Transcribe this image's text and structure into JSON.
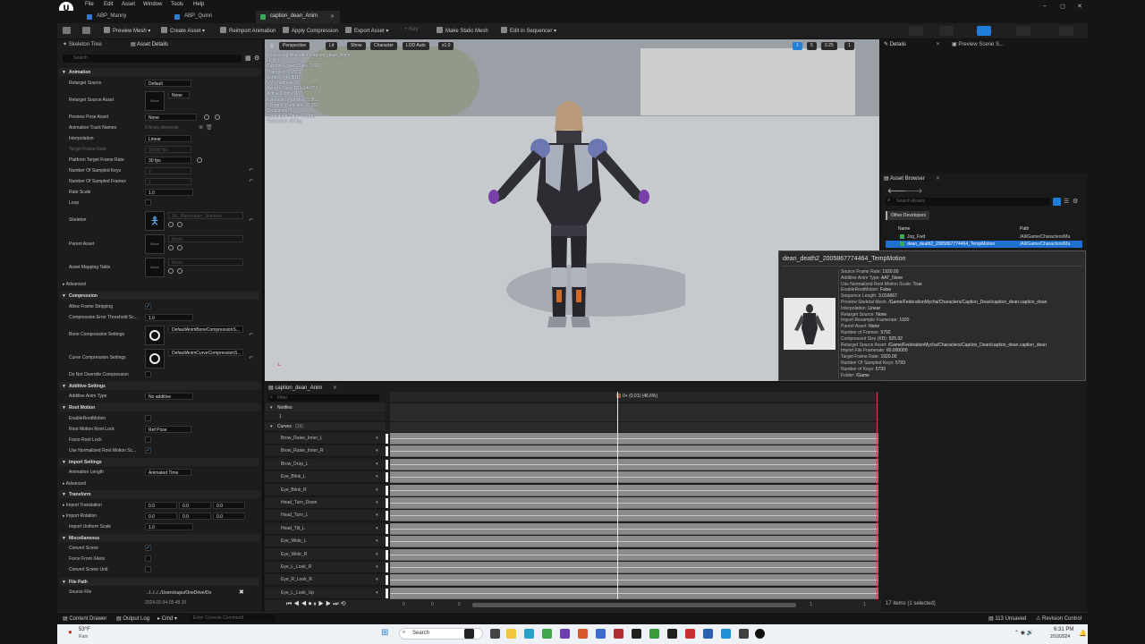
{
  "app": {
    "logo": "U",
    "menu": [
      "File",
      "Edit",
      "Asset",
      "Window",
      "Tools",
      "Help"
    ],
    "doc_tabs": [
      {
        "label": "ABP_Manny",
        "color": "#2e7bd0"
      },
      {
        "label": "ABP_Quinn",
        "color": "#2e7bd0"
      },
      {
        "label": "caption_dean_Anim",
        "color": "#3aa859"
      }
    ],
    "window_controls": [
      "–",
      "◻",
      "✕"
    ]
  },
  "toolbar": {
    "buttons": [
      "Preview Mesh ▾",
      "Create Asset ▾",
      "Reimport Animation",
      "Apply Compression",
      "Export Asset ▾",
      "+ Key",
      "Make Static Mesh",
      "Edit in Sequencer ▾"
    ]
  },
  "left_panel": {
    "tabs": [
      "Skeleton Tree",
      "Asset Details"
    ],
    "search_placeholder": "Search",
    "sections": {
      "animation": "Animation",
      "compression": "Compression",
      "additive": "Additive Settings",
      "root_motion": "Root Motion",
      "import_settings": "Import Settings",
      "transform": "Transform",
      "misc": "Miscellaneous",
      "file_path": "File Path"
    },
    "rows": {
      "retarget_source": {
        "label": "Retarget Source",
        "value": "Default"
      },
      "retarget_source_asset": {
        "label": "Retarget Source Asset",
        "value": "None",
        "thumb": "None"
      },
      "preview_pose": {
        "label": "Preview Pose Asset",
        "value": "None"
      },
      "track_names": {
        "label": "Animation Track Names",
        "value": "0 Array elements"
      },
      "interpolation": {
        "label": "Interpolation",
        "value": "Linear"
      },
      "target_frame_rate": {
        "label": "Target Frame Rate",
        "value": "30000 fps"
      },
      "platform_frame_rate": {
        "label": "Platform Target Frame Rate",
        "value": "30 fps"
      },
      "sampled_keys": {
        "label": "Number Of Sampled Keys",
        "value": "2"
      },
      "sampled_frames": {
        "label": "Number Of Sampled Frames",
        "value": "1"
      },
      "rate_scale": {
        "label": "Rate Scale",
        "value": "1.0"
      },
      "loop": {
        "label": "Loop"
      },
      "skeleton": {
        "label": "Skeleton",
        "value": "SK_Mannequin_Skeleton"
      },
      "parent_asset": {
        "label": "Parent Asset",
        "value": "None",
        "thumb": "None"
      },
      "mapping_table": {
        "label": "Asset Mapping Table",
        "value": "None",
        "thumb": "None"
      },
      "advanced": {
        "label": "Advanced"
      },
      "allow_frame_strip": {
        "label": "Allow Frame Stripping"
      },
      "comp_error": {
        "label": "Compression Error Threshold Sc...",
        "value": "1.0"
      },
      "bone_comp": {
        "label": "Bone Compression Settings",
        "value": "DefaultAnimBoneCompressionS..."
      },
      "curve_comp": {
        "label": "Curve Compression Settings",
        "value": "DefaultAnimCurveCompressionS..."
      },
      "no_override": {
        "label": "Do Not Override Compression"
      },
      "additive_type": {
        "label": "Additive Anim Type",
        "value": "No additive"
      },
      "enable_root": {
        "label": "EnableRootMotion"
      },
      "root_lock": {
        "label": "Root Motion Root Lock",
        "value": "Ref Pose"
      },
      "force_root_lock": {
        "label": "Force Root Lock"
      },
      "use_norm_root": {
        "label": "Use Normalized Root Motion Sc..."
      },
      "anim_length": {
        "label": "Animation Length",
        "value": "Animated Time"
      },
      "advanced2": {
        "label": "Advanced"
      },
      "import_translation": {
        "label": "Import Translation",
        "values": [
          "0.0",
          "0.0",
          "0.0"
        ]
      },
      "import_rotation": {
        "label": "Import Rotation",
        "values": [
          "0.0",
          "0.0",
          "0.0"
        ]
      },
      "import_uniform": {
        "label": "Import Uniform Scale",
        "value": "1.0"
      },
      "convert_scene": {
        "label": "Convert Scene"
      },
      "force_front": {
        "label": "Force Front XAxis"
      },
      "convert_unit": {
        "label": "Convert Scene Unit"
      },
      "source_file": {
        "label": "Source File",
        "value": "../../../../Users/supu/OneDrive/Do",
        "timestamp": "2024.02.04-05.48.10"
      }
    }
  },
  "viewport": {
    "buttons": [
      "Perspective",
      "Lit",
      "Show",
      "Character",
      "LOD Auto",
      "x1.0"
    ],
    "right_buttons": [
      "1",
      "5",
      "0.25",
      "1"
    ],
    "stats": [
      "Previewing Animation caption_dean_Anim",
      "LOD: 0",
      "Current Screen Size: 0.822",
      "Triangles: 73,561",
      "Vertices: 46,881",
      "UV Channels: 2",
      "Approx Size: 120x34x177",
      "Active Cloths: 1",
      "Kinematic Particles: 5,063",
      "Dynamic Particles: 17,053",
      "Simulation: 1",
      "Simulation Time: 0.08ms",
      "Framerate: 60 fps"
    ]
  },
  "details_panel": {
    "tabs": [
      "Details",
      "Preview Scene S..."
    ]
  },
  "asset_browser": {
    "tab": "Asset Browser",
    "search_placeholder": "Search Assets",
    "filter_chip": "Other Developers",
    "columns": [
      "Name",
      "Path"
    ],
    "items": [
      {
        "name": "Jog_Fwd",
        "path": "/All/Game/Characters/Ma"
      },
      {
        "name": "dean_death2_2005867774464_TempMotion",
        "path": "/All/Game/Characters/Ma"
      }
    ],
    "footer": "17 items (1 selected)"
  },
  "tooltip": {
    "title": "dean_death2_2005867774464_TempMotion",
    "lines": [
      [
        "Source Frame Rate:",
        "1920.00"
      ],
      [
        "Additive Anim Type:",
        "AAT_None"
      ],
      [
        "Use Normalized Root Motion Scale:",
        "True"
      ],
      [
        "EnableRootMotion:",
        "False"
      ],
      [
        "Sequence Length:",
        "3.016667"
      ],
      [
        "Preview Skeletal Mesh:",
        "/Game/FederationMycha/Characters/Caption_Dean/caption_dean.caption_dean"
      ],
      [
        "Interpolation:",
        "Linear"
      ],
      [
        "Retarget Source:",
        "None"
      ],
      [
        "Import Resample Framerate:",
        "1920"
      ],
      [
        "Parent Asset:",
        "None"
      ],
      [
        "Number of Frames:",
        "5792"
      ],
      [
        "Compressed Size (KB):",
        "925.92"
      ],
      [
        "Retarget Source Asset:",
        "/Game/FederationMycha/Characters/Caption_Dean/caption_dean.caption_dean"
      ],
      [
        "Import File Framerate:",
        "60.000000"
      ],
      [
        "Target Frame Rate:",
        "1920.00"
      ],
      [
        "Number Of Sampled Keys:",
        "5793"
      ],
      [
        "Number of Keys:",
        "5793"
      ],
      [
        "Folder:",
        "/Game"
      ]
    ]
  },
  "sequencer": {
    "tab": "caption_dean_Anim",
    "filter_placeholder": "Filter",
    "notifies": "Notifies",
    "notify_track": "1",
    "curves_label": "Curves",
    "curves_count": "(16)",
    "playhead": "0+ (0.01) (46.6%)",
    "curves": [
      "Brow_Raise_Inner_L",
      "Brow_Raise_Inner_R",
      "Brow_Drop_L",
      "Eye_Blink_L",
      "Eye_Blink_R",
      "Head_Turn_Down",
      "Head_Turn_L",
      "Head_Tilt_L",
      "Eye_Wide_L",
      "Eye_Wide_R",
      "Eye_L_Look_R",
      "Eye_R_Look_R",
      "Eye_L_Look_Up"
    ],
    "bottom_numbers": [
      "0",
      "0",
      "0",
      "1",
      "1"
    ]
  },
  "statusbar": {
    "content_drawer": "Content Drawer",
    "output_log": "Output Log",
    "cmd": "Cmd ▾",
    "console_placeholder": "Enter Console Command",
    "unsaved": "113 Unsaved",
    "revision": "Revision Control"
  },
  "taskbar": {
    "weather_temp": "53°F",
    "weather_desc": "Rain",
    "search": "Search",
    "time": "6:31 PM",
    "date": "2/10/2024"
  }
}
